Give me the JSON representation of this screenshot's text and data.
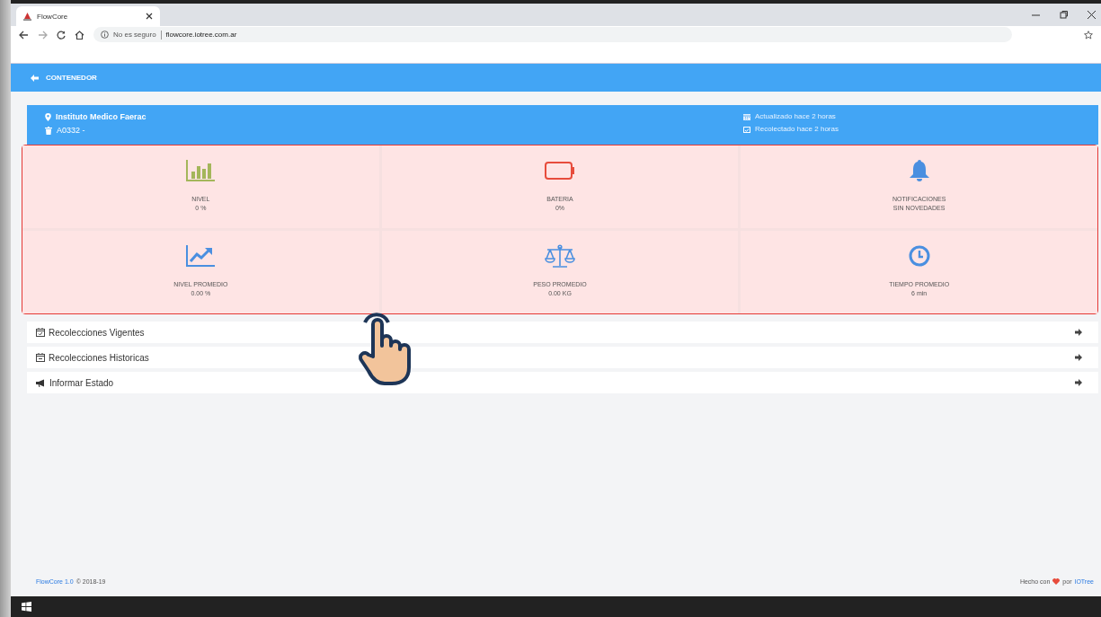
{
  "browser": {
    "tab_title": "FlowCore",
    "security": "No es seguro",
    "url": "flowcore.iotree.com.ar"
  },
  "nav": {
    "title": "CONTENEDOR"
  },
  "header": {
    "location": "Instituto Medico Faerac",
    "container": "A0332 -",
    "updated": "Actualizado hace 2 horas",
    "collected": "Recolectado hace 2 horas"
  },
  "tiles_highlighted": true,
  "tiles": [
    {
      "kind": "level",
      "label": "NIVEL",
      "value": "0 %"
    },
    {
      "kind": "battery",
      "label": "BATERIA",
      "value": "0%"
    },
    {
      "kind": "notifications",
      "label": "NOTIFICACIONES",
      "value": "SIN NOVEDADES"
    },
    {
      "kind": "trend",
      "label": "NIVEL PROMEDIO",
      "value": "0.00 %"
    },
    {
      "kind": "weight",
      "label": "PESO PROMEDIO",
      "value": "0.00 KG"
    },
    {
      "kind": "time",
      "label": "TIEMPO PROMEDIO",
      "value": "6 min"
    }
  ],
  "links": [
    {
      "kind": "calendar-check",
      "label": "Recolecciones Vigentes"
    },
    {
      "kind": "calendar-minus",
      "label": "Recolecciones Historicas"
    },
    {
      "kind": "megaphone",
      "label": "Informar Estado"
    }
  ],
  "footer": {
    "brand": "FlowCore 1.0",
    "copyright": "© 2018-19",
    "made_with": "Hecho con",
    "by": "por",
    "company": "IOTree"
  }
}
